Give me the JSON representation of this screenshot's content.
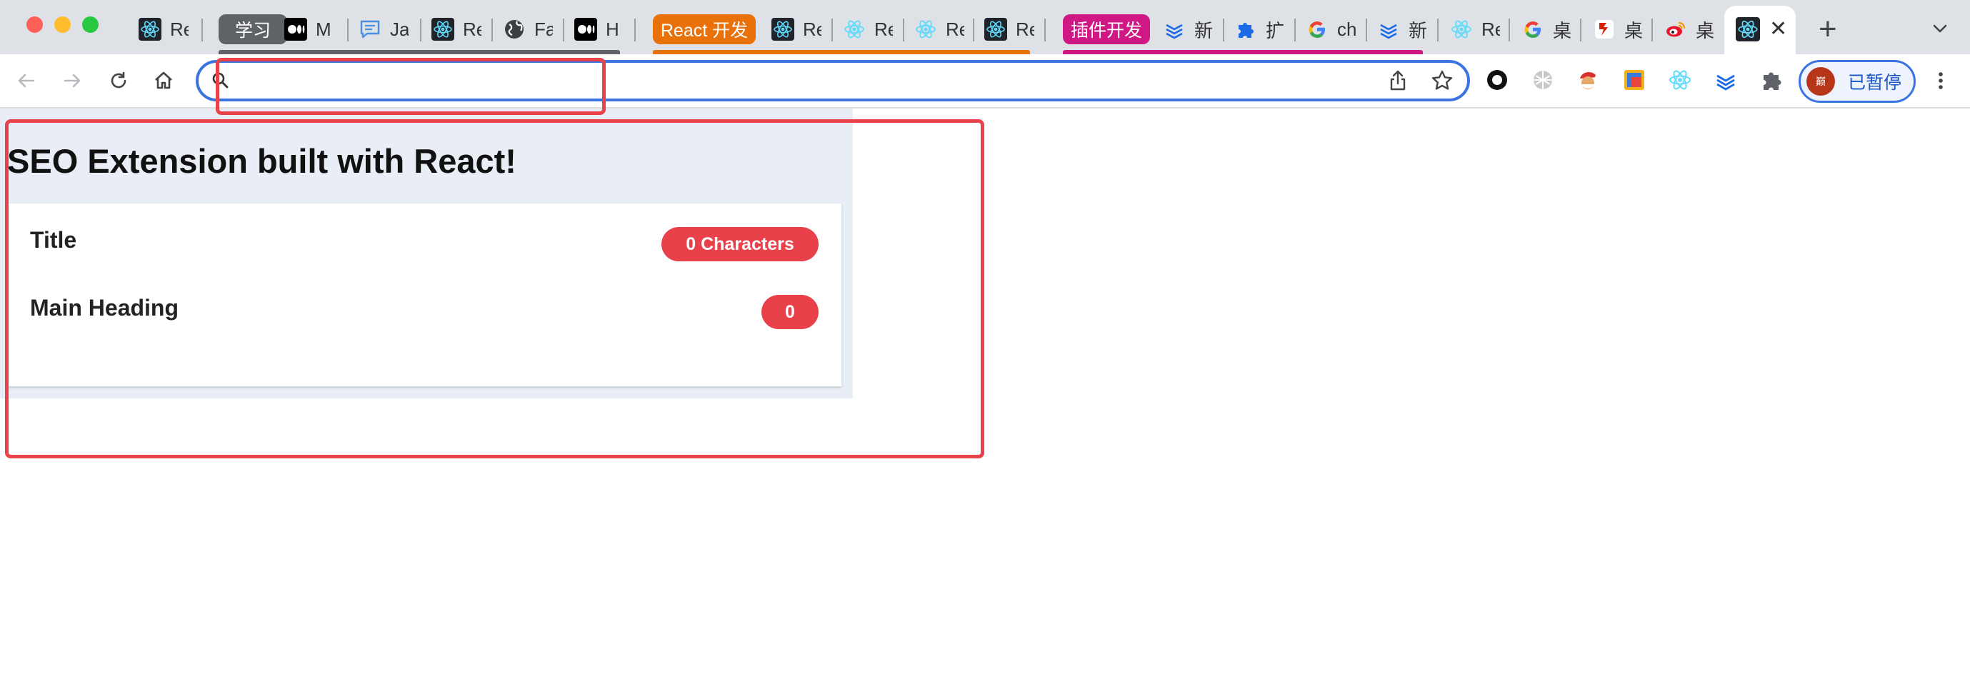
{
  "browser": {
    "tabs": [
      {
        "icon": "react-icon",
        "title": "Re"
      },
      {
        "group_chip": "学习",
        "group_color": "#5f6368"
      },
      {
        "icon": "medium-icon",
        "title": "M"
      },
      {
        "icon": "chat-bubble-icon",
        "title": "Ja"
      },
      {
        "icon": "react-icon",
        "title": "Re"
      },
      {
        "icon": "globe-icon",
        "title": "Fa"
      },
      {
        "icon": "medium-icon",
        "title": "H"
      },
      {
        "group_chip": "React 开发",
        "group_color": "#e8710a"
      },
      {
        "icon": "react-icon",
        "title": "Re"
      },
      {
        "icon": "react-icon",
        "title": "Re"
      },
      {
        "icon": "react-icon",
        "title": "Re"
      },
      {
        "icon": "react-icon",
        "title": "Re"
      },
      {
        "group_chip": "插件开发",
        "group_color": "#d01884"
      },
      {
        "icon": "yuque-icon",
        "title": "新"
      },
      {
        "icon": "puzzle-icon",
        "title": "扩"
      },
      {
        "icon": "google-icon",
        "title": "ch"
      },
      {
        "icon": "yuque-icon",
        "title": "新"
      },
      {
        "icon": "react-icon",
        "title": "Re"
      },
      {
        "icon": "google-icon",
        "title": "桌"
      },
      {
        "icon": "netease-icon",
        "title": "桌"
      },
      {
        "icon": "weibo-icon",
        "title": "桌"
      },
      {
        "icon": "react-icon",
        "title": "",
        "active": true
      }
    ],
    "new_tab_symbol": "+",
    "active_tab_close": "✕",
    "omnibox": {
      "value": "",
      "placeholder": ""
    },
    "profile": {
      "label": "已暂停",
      "avatar_text": "巅"
    },
    "colors": {
      "accent": "#3b74e0",
      "annotation": "#e8434a",
      "popup_bg": "#e9eef6",
      "badge": "#e8414a"
    }
  },
  "popup": {
    "heading": "SEO Extension built with React!",
    "rows": [
      {
        "label": "Title",
        "badge": "0 Characters"
      },
      {
        "label": "Main Heading",
        "badge": "0"
      }
    ]
  }
}
